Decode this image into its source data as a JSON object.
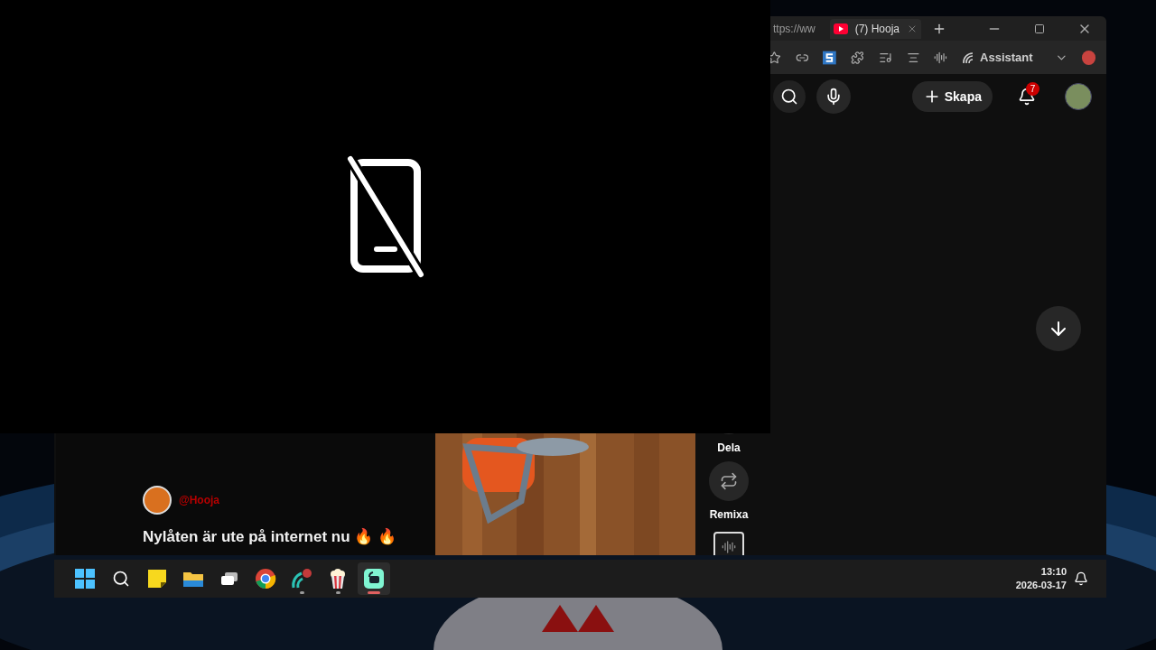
{
  "browser": {
    "tabs": [
      {
        "title": "ttps://ww",
        "kind": "web",
        "selected": false
      },
      {
        "title": "(7) Hooja",
        "kind": "video",
        "selected": true
      }
    ],
    "toolbar": {
      "assistant_label": "Assistant"
    },
    "header": {
      "create_label": "Skapa",
      "notification_count": "7"
    },
    "short": {
      "channel": "@Hooja",
      "title": "Nylåten är ute på internet nu 🔥 🔥",
      "actions": [
        {
          "label": "Dela",
          "kind": "share"
        },
        {
          "label": "Remixa",
          "kind": "remix"
        }
      ]
    }
  },
  "taskbar": {
    "apps": [
      {
        "kind": "start",
        "running": false,
        "selected": false
      },
      {
        "kind": "search",
        "running": false,
        "selected": false
      },
      {
        "kind": "notes",
        "running": false,
        "selected": false
      },
      {
        "kind": "folder",
        "running": false,
        "selected": false
      },
      {
        "kind": "chat",
        "running": false,
        "selected": false
      },
      {
        "kind": "chrome",
        "running": false,
        "selected": false
      },
      {
        "kind": "wave",
        "running": true,
        "selected": false
      },
      {
        "kind": "popcorn",
        "running": true,
        "selected": false
      },
      {
        "kind": "stream",
        "running": true,
        "selected": true
      }
    ],
    "time": "13:10",
    "date": "2026-03-17"
  }
}
